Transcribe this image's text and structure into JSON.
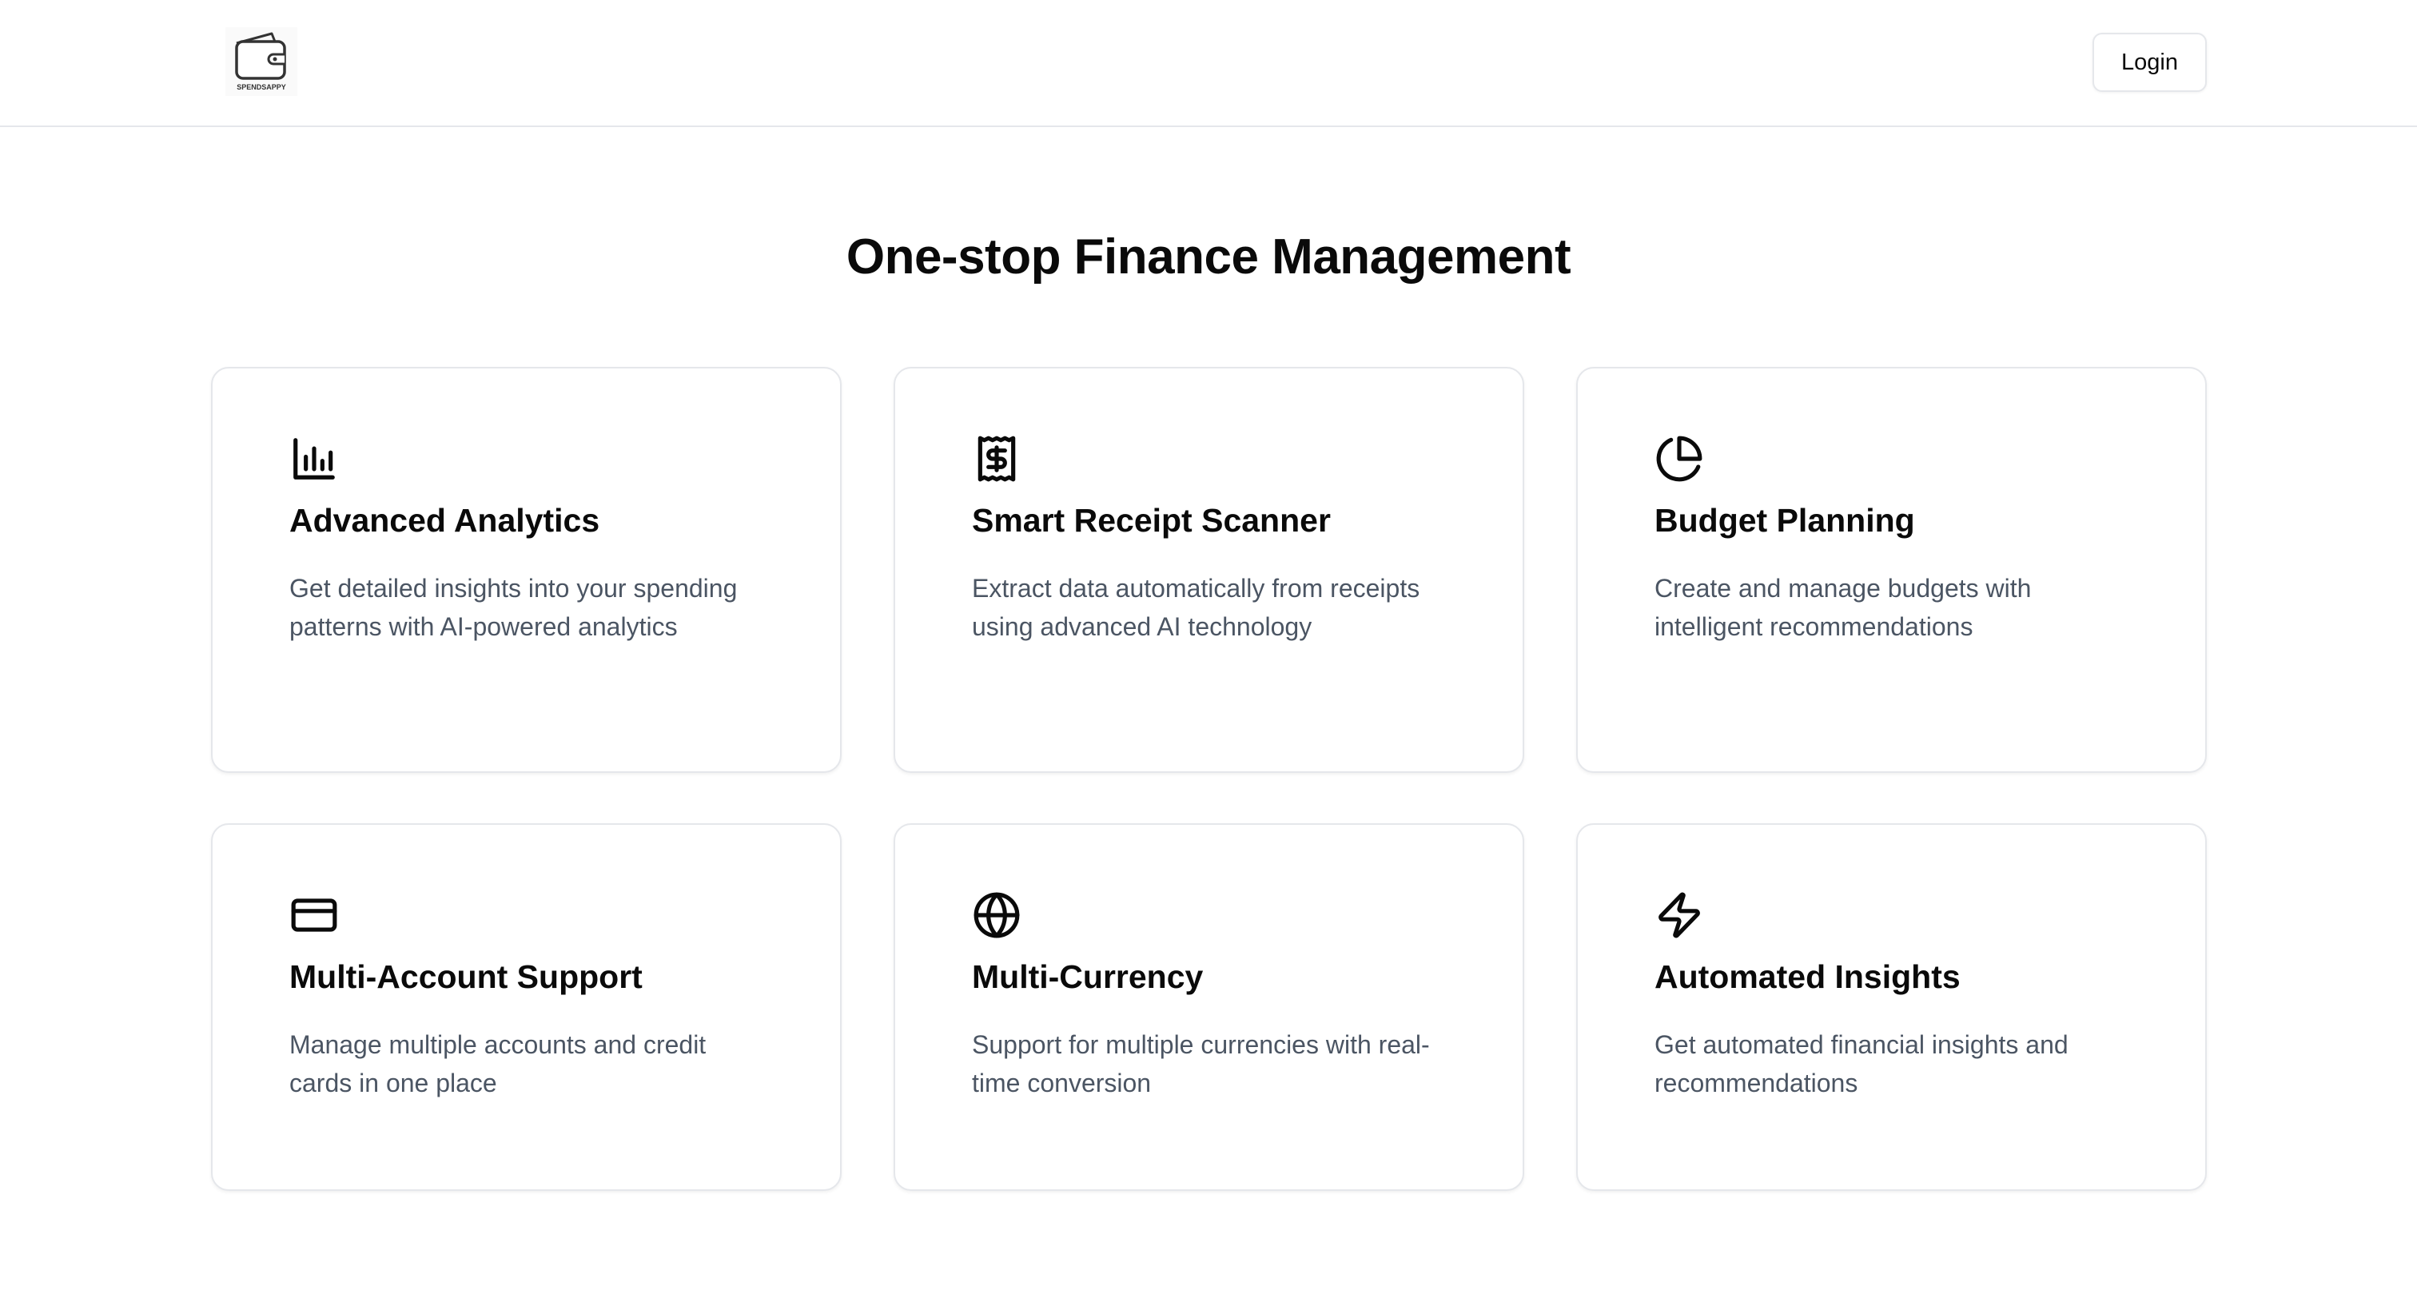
{
  "header": {
    "logo_text": "SPENDSAPPY",
    "login_label": "Login"
  },
  "main": {
    "title": "One-stop Finance Management",
    "features": [
      {
        "icon": "bar-chart-icon",
        "title": "Advanced Analytics",
        "description": "Get detailed insights into your spending patterns with AI-powered analytics"
      },
      {
        "icon": "receipt-dollar-icon",
        "title": "Smart Receipt Scanner",
        "description": "Extract data automatically from receipts using advanced AI technology"
      },
      {
        "icon": "pie-chart-icon",
        "title": "Budget Planning",
        "description": "Create and manage budgets with intelligent recommendations"
      },
      {
        "icon": "credit-card-icon",
        "title": "Multi-Account Support",
        "description": "Manage multiple accounts and credit cards in one place"
      },
      {
        "icon": "globe-icon",
        "title": "Multi-Currency",
        "description": "Support for multiple currencies with real-time conversion"
      },
      {
        "icon": "lightning-bolt-icon",
        "title": "Automated Insights",
        "description": "Get automated financial insights and recommendations"
      }
    ]
  },
  "colors": {
    "text": "#0a0a0a",
    "muted_text": "#4b5563",
    "border": "#e5e7eb",
    "background": "#ffffff"
  }
}
